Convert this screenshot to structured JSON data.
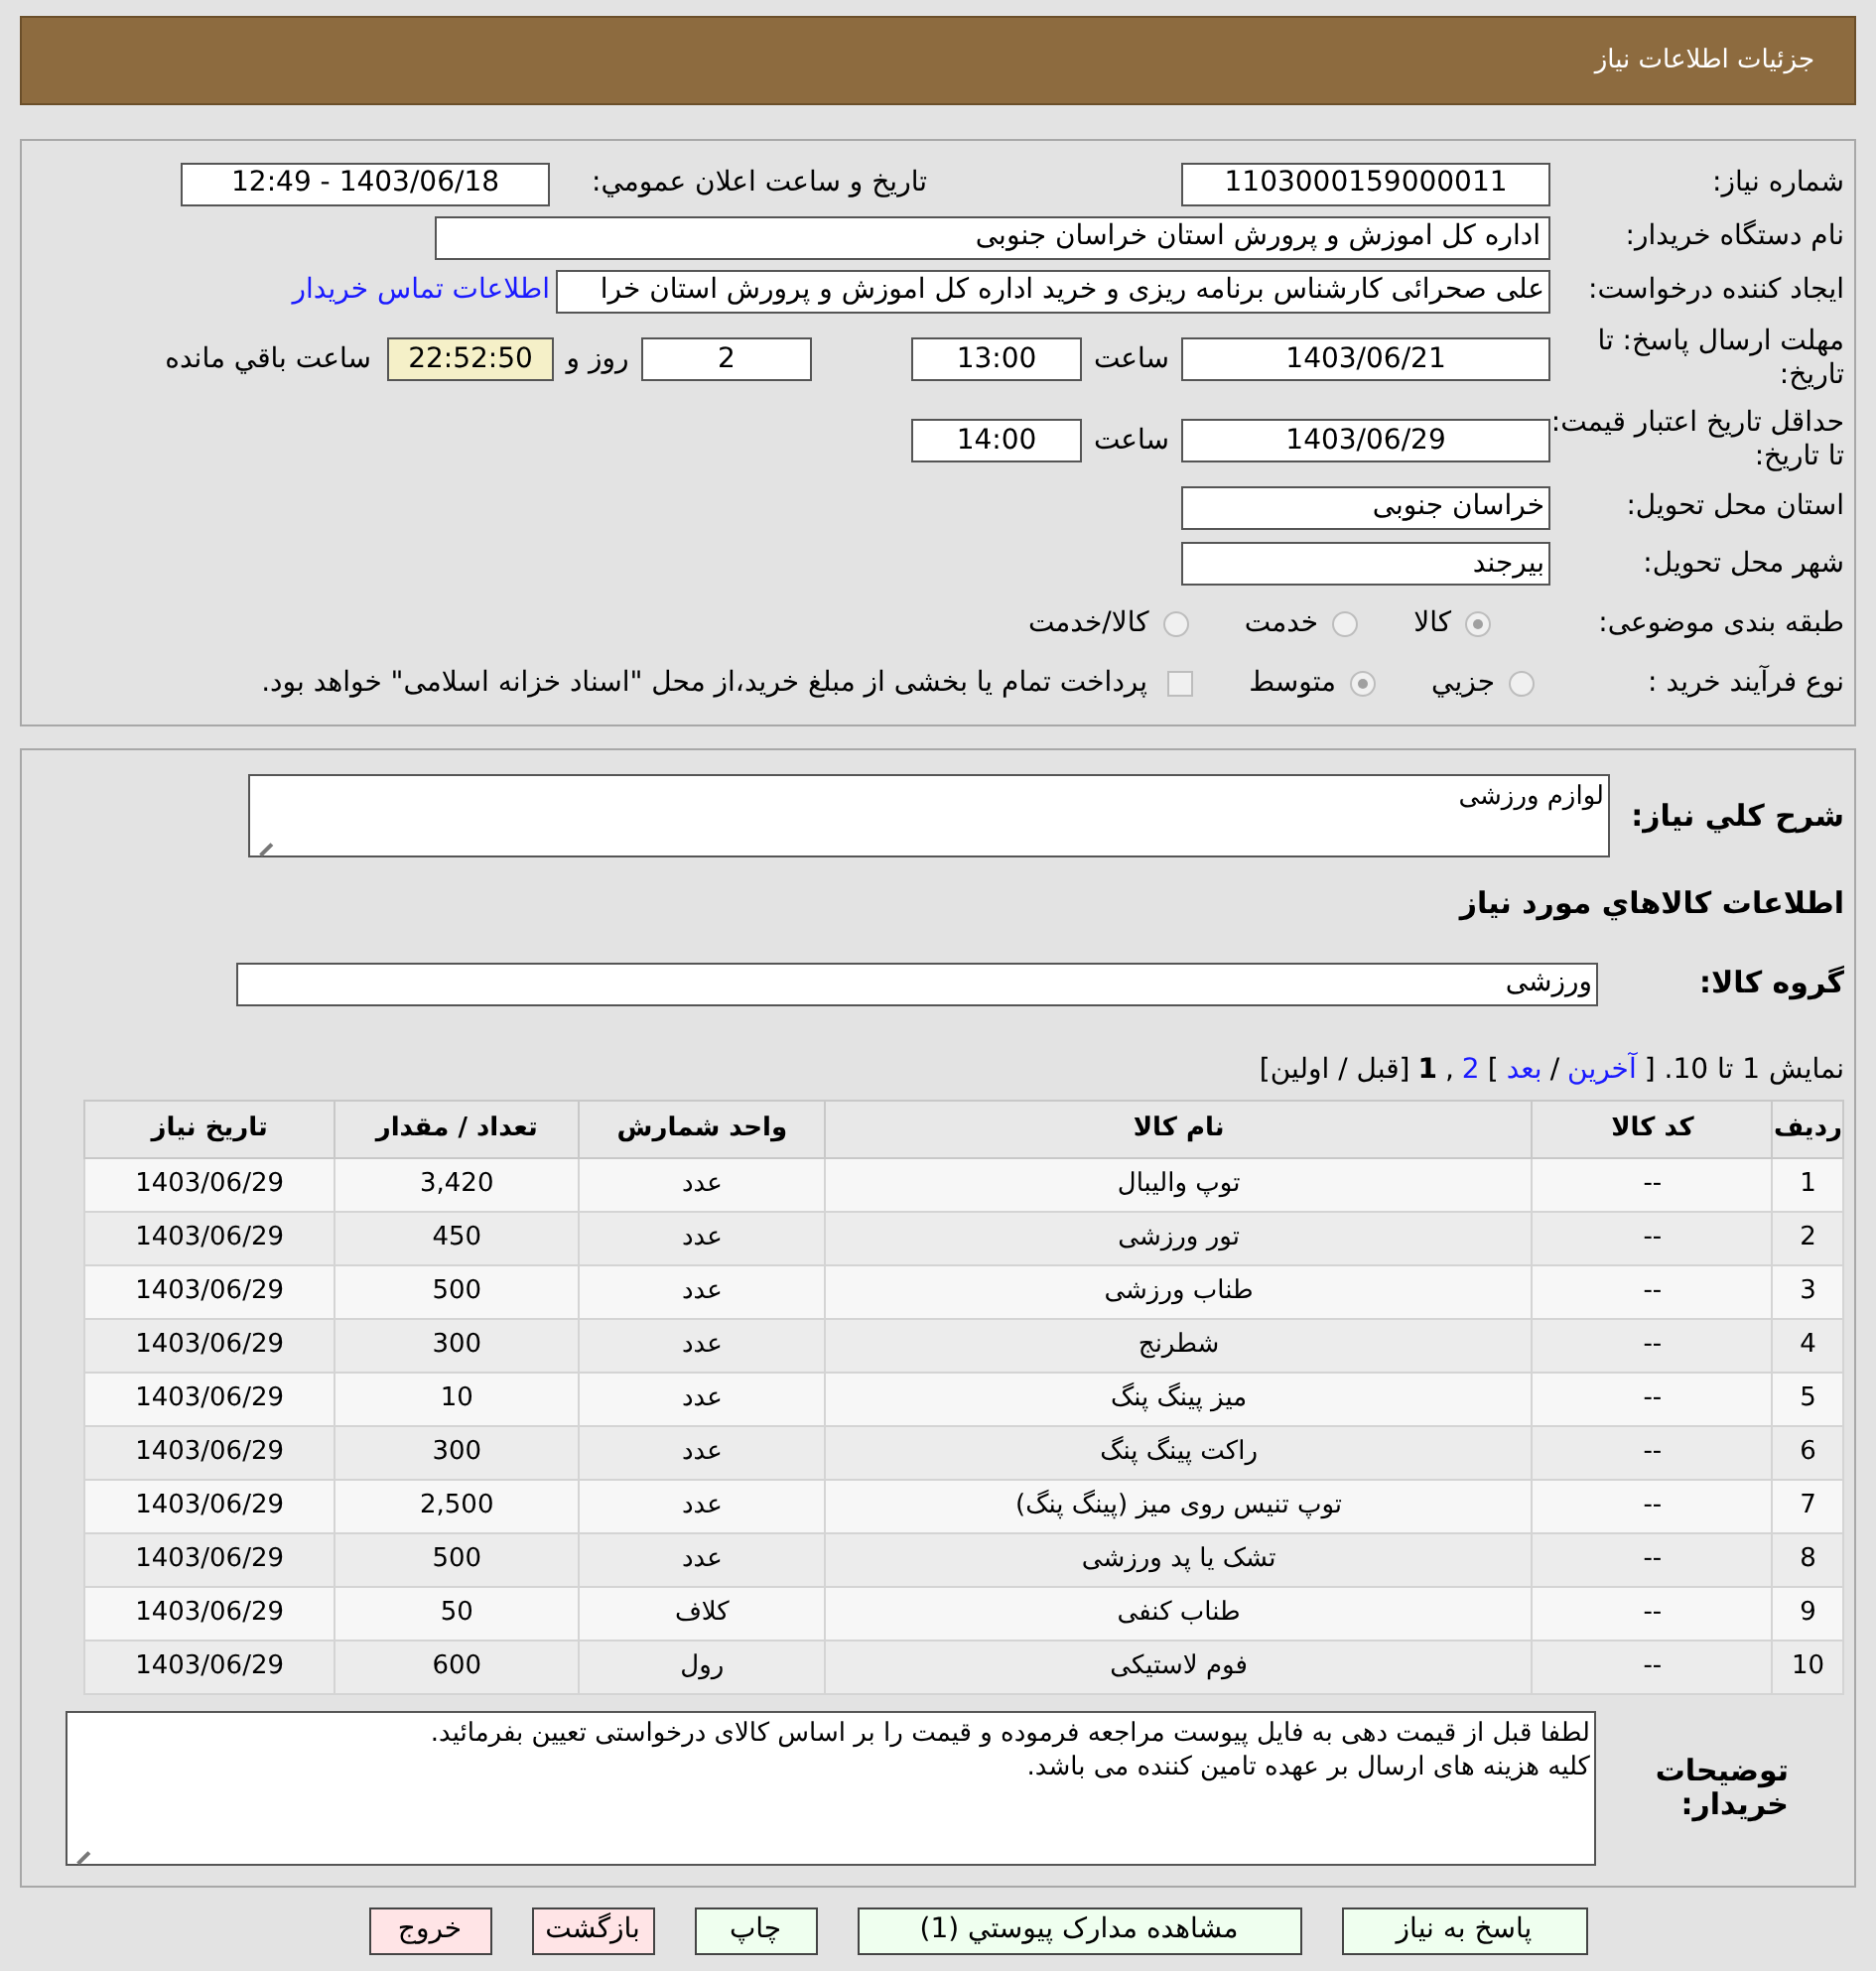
{
  "header": {
    "title": "جزئیات اطلاعات نیاز"
  },
  "details": {
    "need_number": {
      "label": "شماره نیاز:",
      "value": "1103000159000011"
    },
    "announce": {
      "label": "تاریخ و ساعت اعلان عمومي:",
      "value": "1403/06/18 - 12:49"
    },
    "buyer": {
      "label": "نام دستگاه خریدار:",
      "value": "اداره کل اموزش و پرورش استان خراسان جنوبی"
    },
    "creator": {
      "label": "ایجاد کننده درخواست:",
      "value": "علی صحرائی کارشناس برنامه ریزی و خرید اداره کل اموزش و پرورش استان خرا",
      "link": "اطلاعات تماس خریدار"
    },
    "deadline": {
      "label": "مهلت ارسال پاسخ: تا تاریخ:",
      "date": "1403/06/21",
      "time_label": "ساعت",
      "time": "13:00",
      "days": "2",
      "days_label": "روز و",
      "remaining": "22:52:50",
      "remaining_label": "ساعت باقي مانده"
    },
    "validity": {
      "label": "حداقل تاریخ اعتبار قیمت: تا تاریخ:",
      "date": "1403/06/29",
      "time_label": "ساعت",
      "time": "14:00"
    },
    "province": {
      "label": "استان محل تحویل:",
      "value": "خراسان جنوبی"
    },
    "city": {
      "label": "شهر محل تحویل:",
      "value": "بیرجند"
    },
    "category": {
      "label": "طبقه بندی موضوعی:",
      "options": [
        {
          "label": "کالا",
          "selected": true
        },
        {
          "label": "خدمت",
          "selected": false
        },
        {
          "label": "کالا/خدمت",
          "selected": false
        }
      ]
    },
    "process": {
      "label": "نوع فرآیند خرید :",
      "options": [
        {
          "label": "جزيي",
          "selected": false
        },
        {
          "label": "متوسط",
          "selected": true
        }
      ],
      "payment": {
        "label": "پرداخت تمام یا بخشی از مبلغ خرید،از محل \"اسناد خزانه اسلامی\" خواهد بود.",
        "checked": false
      }
    }
  },
  "summary": {
    "label": "شرح کلي نياز:",
    "value": "لوازم ورزشی"
  },
  "goods_heading": "اطلاعات کالاهاي مورد نياز",
  "goods_group": {
    "label": "گروه کالا:",
    "value": "ورزشی"
  },
  "pagination": {
    "prefix": "نمایش 1 تا 10. [",
    "last": "آخرین",
    "sep": "/",
    "next": "بعد",
    "close": "]",
    "page_2": "2",
    "comma": ",",
    "page_1": "1",
    "rest": "[قبل / اولین]"
  },
  "table": {
    "columns": [
      "ردیف",
      "کد کالا",
      "نام کالا",
      "واحد شمارش",
      "تعداد / مقدار",
      "تاریخ نیاز"
    ],
    "rows": [
      [
        "1",
        "--",
        "توپ والیبال",
        "عدد",
        "3,420",
        "1403/06/29"
      ],
      [
        "2",
        "--",
        "تور ورزشی",
        "عدد",
        "450",
        "1403/06/29"
      ],
      [
        "3",
        "--",
        "طناب ورزشی",
        "عدد",
        "500",
        "1403/06/29"
      ],
      [
        "4",
        "--",
        "شطرنج",
        "عدد",
        "300",
        "1403/06/29"
      ],
      [
        "5",
        "--",
        "میز پینگ پنگ",
        "عدد",
        "10",
        "1403/06/29"
      ],
      [
        "6",
        "--",
        "راکت پینگ پنگ",
        "عدد",
        "300",
        "1403/06/29"
      ],
      [
        "7",
        "--",
        "توپ تنیس روی میز (پینگ پنگ)",
        "عدد",
        "2,500",
        "1403/06/29"
      ],
      [
        "8",
        "--",
        "تشک یا پد ورزشی",
        "عدد",
        "500",
        "1403/06/29"
      ],
      [
        "9",
        "--",
        "طناب کنفی",
        "کلاف",
        "50",
        "1403/06/29"
      ],
      [
        "10",
        "--",
        "فوم لاستیکی",
        "رول",
        "600",
        "1403/06/29"
      ]
    ]
  },
  "notes": {
    "label": "توضیحات خریدار:",
    "lines": [
      "لطفا قبل از قیمت دهی به فایل پیوست مراجعه فرموده و قیمت را بر اساس کالای درخواستی تعیین بفرمائید.",
      "کلیه هزینه های ارسال بر عهده تامین کننده می باشد."
    ]
  },
  "buttons": [
    {
      "label": "پاسخ به نیاز",
      "kind": "action"
    },
    {
      "label": "مشاهده مدارک پیوستي (1)",
      "kind": "action"
    },
    {
      "label": "چاپ",
      "kind": "action"
    },
    {
      "label": "بازگشت",
      "kind": "exit"
    },
    {
      "label": "خروج",
      "kind": "exit"
    }
  ]
}
